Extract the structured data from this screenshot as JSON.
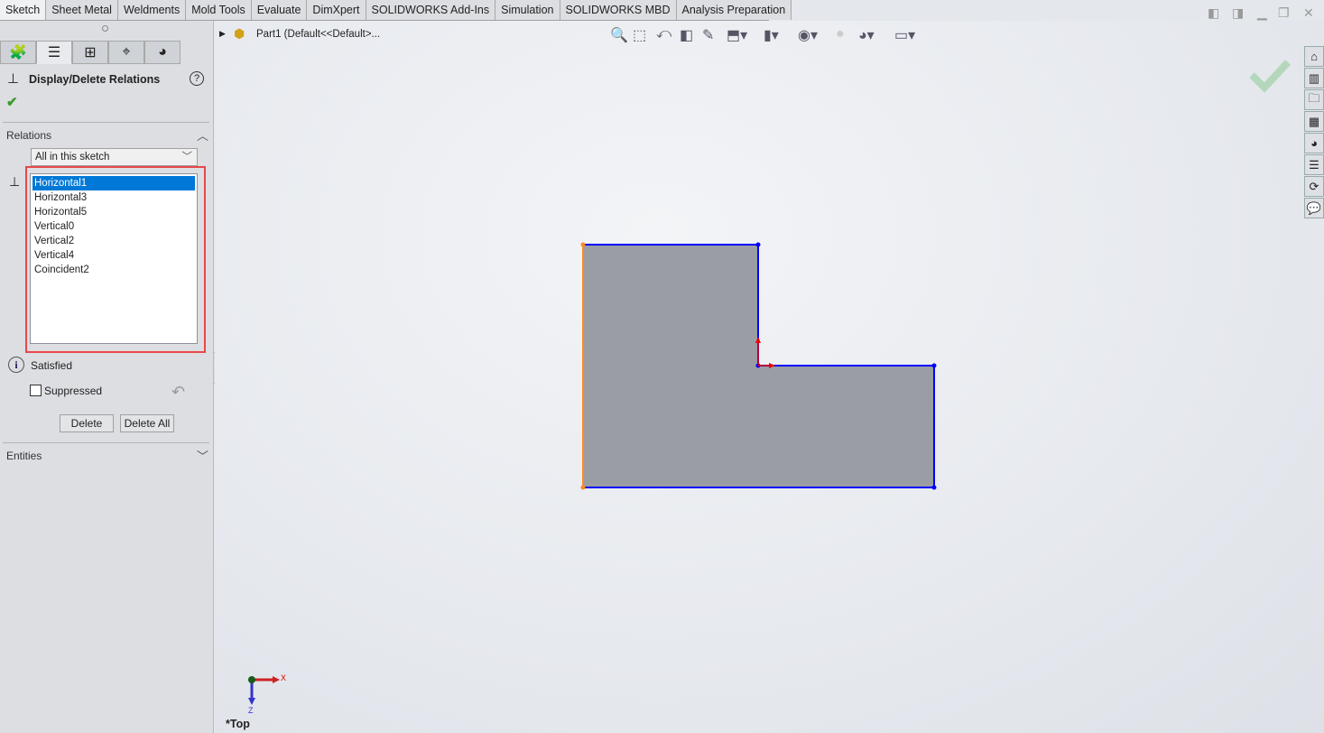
{
  "ribbon_tabs": [
    "Sketch",
    "Sheet Metal",
    "Weldments",
    "Mold Tools",
    "Evaluate",
    "DimXpert",
    "SOLIDWORKS Add-Ins",
    "Simulation",
    "SOLIDWORKS MBD",
    "Analysis Preparation"
  ],
  "panel": {
    "title": "Display/Delete Relations",
    "relations_header": "Relations",
    "filter_value": "All in this sketch",
    "relations": [
      "Horizontal1",
      "Horizontal3",
      "Horizontal5",
      "Vertical0",
      "Vertical2",
      "Vertical4",
      "Coincident2"
    ],
    "selected_relation": "Horizontal1",
    "status": "Satisfied",
    "suppressed_label": "Suppressed",
    "suppressed": false,
    "delete_label": "Delete",
    "delete_all_label": "Delete All",
    "entities_header": "Entities"
  },
  "tree": {
    "part": "Part1  (Default<<Default>..."
  },
  "view": {
    "orientation": "*Top",
    "x_axis": "X",
    "z_axis": "Z"
  },
  "colors": {
    "accent": "#0078d7",
    "highlight_box": "#e8484a",
    "sketch_line": "#0000ff",
    "selected_edge": "#ff8a1f",
    "fill": "#9a9ca3"
  }
}
